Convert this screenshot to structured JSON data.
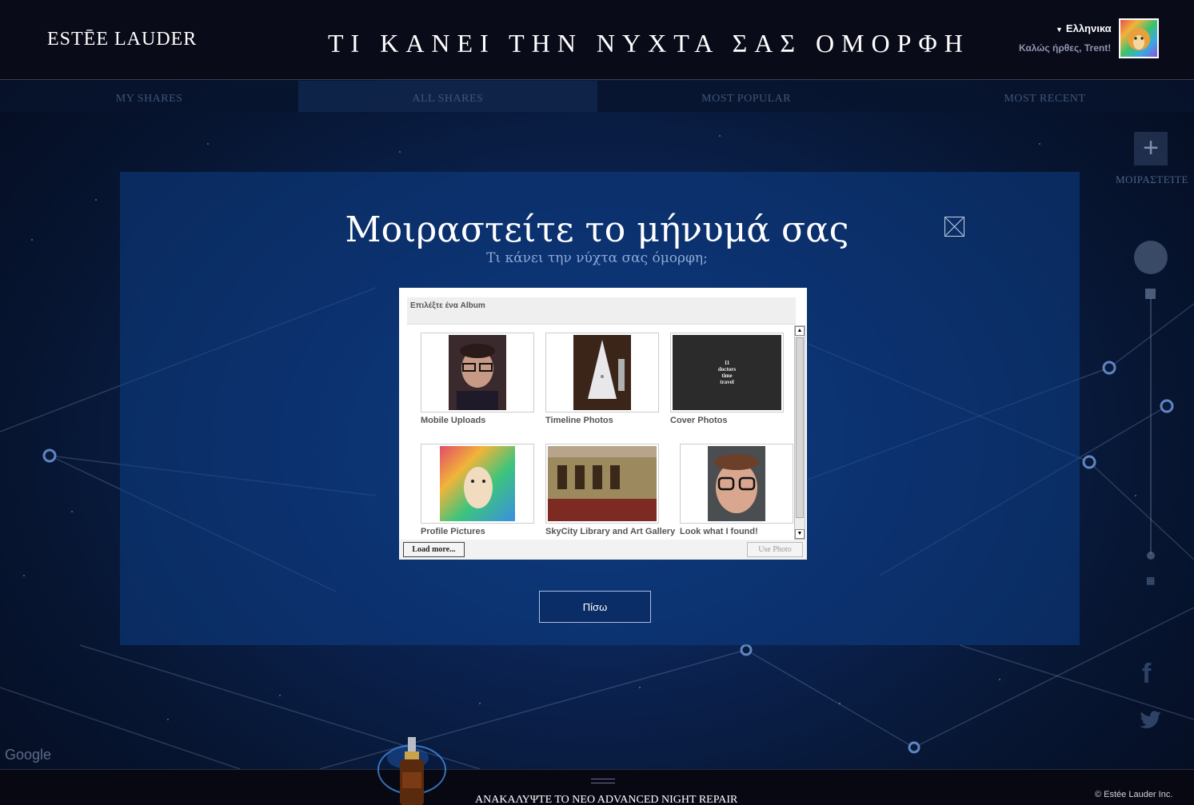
{
  "header": {
    "logo": "ESTĒE LAUDER",
    "headline": "ΤΙ ΚΑΝΕΙ ΤΗΝ ΝΥΧΤΑ ΣΑΣ ΟΜΟΡΦΗ",
    "language": "Ελληνικα",
    "welcome": "Καλώς ήρθες, Trent!"
  },
  "nav": {
    "items": [
      {
        "label": "MY SHARES",
        "active": false
      },
      {
        "label": "ALL SHARES",
        "active": true
      },
      {
        "label": "MOST POPULAR",
        "active": false
      },
      {
        "label": "MOST RECENT",
        "active": false
      }
    ]
  },
  "side": {
    "share_label": "ΜΟΙΡΑΣΤΕΊΤΕ",
    "facebook": "f"
  },
  "map": {
    "attribution": "Google"
  },
  "modal": {
    "title": "Μοιραστείτε το μήνυμά σας",
    "subtitle": "Τι κάνει την νύχτα σας όμορφη;",
    "back_label": "Πίσω"
  },
  "picker": {
    "heading": "Επιλέξτε ένα Album",
    "albums": [
      {
        "label": "Mobile Uploads"
      },
      {
        "label": "Timeline Photos"
      },
      {
        "label": "Cover Photos",
        "thumb_text": "11 doctors time travel"
      },
      {
        "label": "Profile Pictures"
      },
      {
        "label": "SkyCity Library and Art Gallery"
      },
      {
        "label": "Look what I found!"
      }
    ],
    "load_more": "Load more...",
    "use_photo": "Use Photo"
  },
  "footer": {
    "promo_prefix": "ΑΝΑΚΑΛΥΨΤΕ ΤΟ",
    "promo_product": "NEO ADVANCED NIGHT REPAIR",
    "copyright": "© Estée Lauder Inc."
  },
  "colors": {
    "header_bg": "#0a0b19",
    "overlay": "#0d3e87",
    "nav_text": "#3e5578",
    "subtitle": "#8ea9d6"
  }
}
